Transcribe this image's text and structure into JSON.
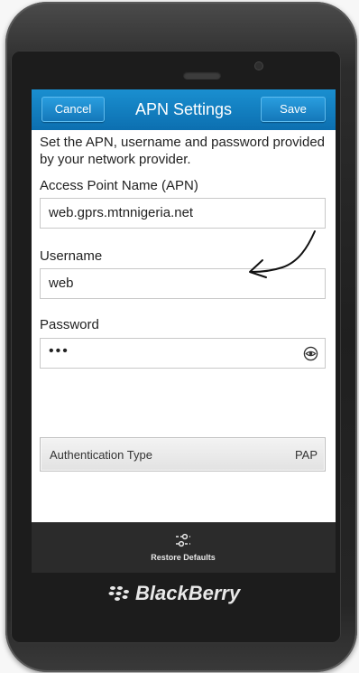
{
  "titlebar": {
    "cancel_label": "Cancel",
    "title": "APN Settings",
    "save_label": "Save"
  },
  "intro_text": "Set the APN, username and password provided by your network provider.",
  "fields": {
    "apn_label": "Access Point Name (APN)",
    "apn_value": "web.gprs.mtnnigeria.net",
    "username_label": "Username",
    "username_value": "web",
    "password_label": "Password",
    "password_value": "•••"
  },
  "auth": {
    "label": "Authentication Type",
    "value": "PAP"
  },
  "actionbar": {
    "restore_label": "Restore Defaults",
    "restore_icon": "sliders-icon"
  },
  "device": {
    "brand": "BlackBerry",
    "body_color": "#232323"
  },
  "colors": {
    "titlebar": "#0c6fb0",
    "accent": "#1a8fd0",
    "actionbar": "#2b2b2b"
  },
  "icons": {
    "eye": "eye-icon",
    "annotation": "hand-drawn-arrow-icon"
  }
}
